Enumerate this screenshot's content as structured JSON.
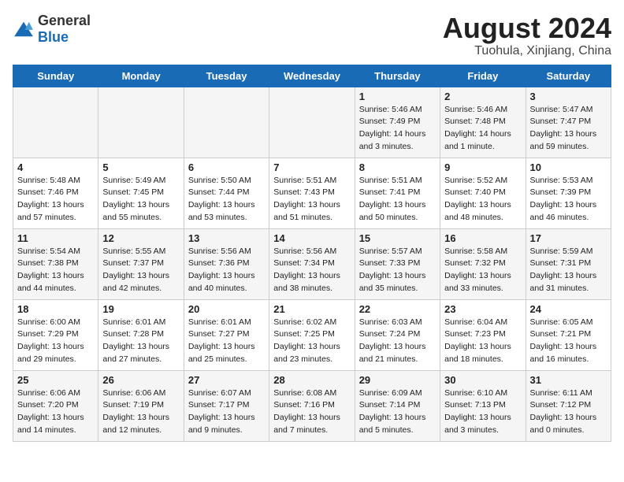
{
  "logo": {
    "general": "General",
    "blue": "Blue"
  },
  "title": "August 2024",
  "subtitle": "Tuohula, Xinjiang, China",
  "days_of_week": [
    "Sunday",
    "Monday",
    "Tuesday",
    "Wednesday",
    "Thursday",
    "Friday",
    "Saturday"
  ],
  "weeks": [
    [
      {
        "day": "",
        "info": ""
      },
      {
        "day": "",
        "info": ""
      },
      {
        "day": "",
        "info": ""
      },
      {
        "day": "",
        "info": ""
      },
      {
        "day": "1",
        "info": "Sunrise: 5:46 AM\nSunset: 7:49 PM\nDaylight: 14 hours\nand 3 minutes."
      },
      {
        "day": "2",
        "info": "Sunrise: 5:46 AM\nSunset: 7:48 PM\nDaylight: 14 hours\nand 1 minute."
      },
      {
        "day": "3",
        "info": "Sunrise: 5:47 AM\nSunset: 7:47 PM\nDaylight: 13 hours\nand 59 minutes."
      }
    ],
    [
      {
        "day": "4",
        "info": "Sunrise: 5:48 AM\nSunset: 7:46 PM\nDaylight: 13 hours\nand 57 minutes."
      },
      {
        "day": "5",
        "info": "Sunrise: 5:49 AM\nSunset: 7:45 PM\nDaylight: 13 hours\nand 55 minutes."
      },
      {
        "day": "6",
        "info": "Sunrise: 5:50 AM\nSunset: 7:44 PM\nDaylight: 13 hours\nand 53 minutes."
      },
      {
        "day": "7",
        "info": "Sunrise: 5:51 AM\nSunset: 7:43 PM\nDaylight: 13 hours\nand 51 minutes."
      },
      {
        "day": "8",
        "info": "Sunrise: 5:51 AM\nSunset: 7:41 PM\nDaylight: 13 hours\nand 50 minutes."
      },
      {
        "day": "9",
        "info": "Sunrise: 5:52 AM\nSunset: 7:40 PM\nDaylight: 13 hours\nand 48 minutes."
      },
      {
        "day": "10",
        "info": "Sunrise: 5:53 AM\nSunset: 7:39 PM\nDaylight: 13 hours\nand 46 minutes."
      }
    ],
    [
      {
        "day": "11",
        "info": "Sunrise: 5:54 AM\nSunset: 7:38 PM\nDaylight: 13 hours\nand 44 minutes."
      },
      {
        "day": "12",
        "info": "Sunrise: 5:55 AM\nSunset: 7:37 PM\nDaylight: 13 hours\nand 42 minutes."
      },
      {
        "day": "13",
        "info": "Sunrise: 5:56 AM\nSunset: 7:36 PM\nDaylight: 13 hours\nand 40 minutes."
      },
      {
        "day": "14",
        "info": "Sunrise: 5:56 AM\nSunset: 7:34 PM\nDaylight: 13 hours\nand 38 minutes."
      },
      {
        "day": "15",
        "info": "Sunrise: 5:57 AM\nSunset: 7:33 PM\nDaylight: 13 hours\nand 35 minutes."
      },
      {
        "day": "16",
        "info": "Sunrise: 5:58 AM\nSunset: 7:32 PM\nDaylight: 13 hours\nand 33 minutes."
      },
      {
        "day": "17",
        "info": "Sunrise: 5:59 AM\nSunset: 7:31 PM\nDaylight: 13 hours\nand 31 minutes."
      }
    ],
    [
      {
        "day": "18",
        "info": "Sunrise: 6:00 AM\nSunset: 7:29 PM\nDaylight: 13 hours\nand 29 minutes."
      },
      {
        "day": "19",
        "info": "Sunrise: 6:01 AM\nSunset: 7:28 PM\nDaylight: 13 hours\nand 27 minutes."
      },
      {
        "day": "20",
        "info": "Sunrise: 6:01 AM\nSunset: 7:27 PM\nDaylight: 13 hours\nand 25 minutes."
      },
      {
        "day": "21",
        "info": "Sunrise: 6:02 AM\nSunset: 7:25 PM\nDaylight: 13 hours\nand 23 minutes."
      },
      {
        "day": "22",
        "info": "Sunrise: 6:03 AM\nSunset: 7:24 PM\nDaylight: 13 hours\nand 21 minutes."
      },
      {
        "day": "23",
        "info": "Sunrise: 6:04 AM\nSunset: 7:23 PM\nDaylight: 13 hours\nand 18 minutes."
      },
      {
        "day": "24",
        "info": "Sunrise: 6:05 AM\nSunset: 7:21 PM\nDaylight: 13 hours\nand 16 minutes."
      }
    ],
    [
      {
        "day": "25",
        "info": "Sunrise: 6:06 AM\nSunset: 7:20 PM\nDaylight: 13 hours\nand 14 minutes."
      },
      {
        "day": "26",
        "info": "Sunrise: 6:06 AM\nSunset: 7:19 PM\nDaylight: 13 hours\nand 12 minutes."
      },
      {
        "day": "27",
        "info": "Sunrise: 6:07 AM\nSunset: 7:17 PM\nDaylight: 13 hours\nand 9 minutes."
      },
      {
        "day": "28",
        "info": "Sunrise: 6:08 AM\nSunset: 7:16 PM\nDaylight: 13 hours\nand 7 minutes."
      },
      {
        "day": "29",
        "info": "Sunrise: 6:09 AM\nSunset: 7:14 PM\nDaylight: 13 hours\nand 5 minutes."
      },
      {
        "day": "30",
        "info": "Sunrise: 6:10 AM\nSunset: 7:13 PM\nDaylight: 13 hours\nand 3 minutes."
      },
      {
        "day": "31",
        "info": "Sunrise: 6:11 AM\nSunset: 7:12 PM\nDaylight: 13 hours\nand 0 minutes."
      }
    ]
  ]
}
